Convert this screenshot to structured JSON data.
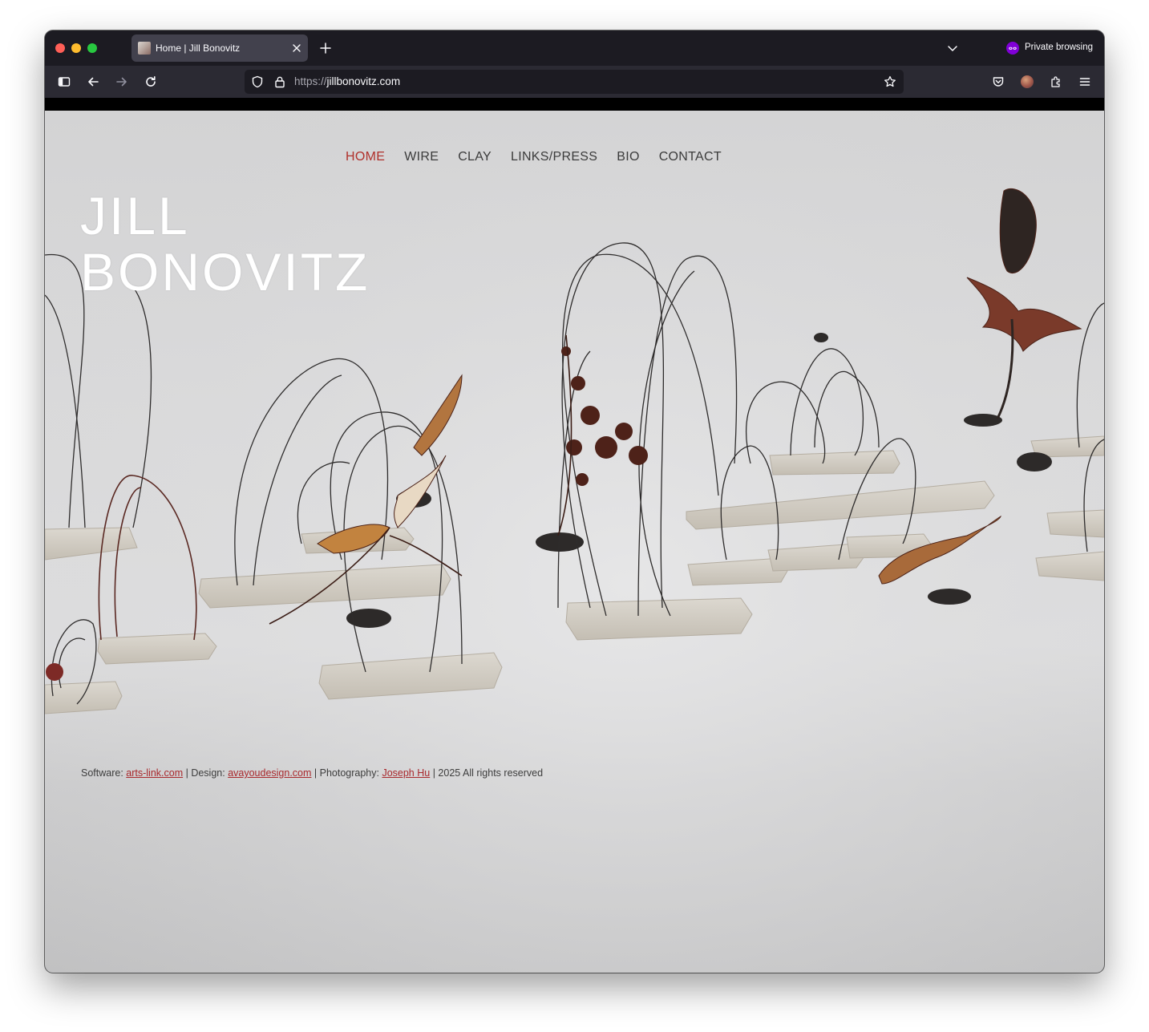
{
  "browser": {
    "tab": {
      "title": "Home | Jill Bonovitz"
    },
    "private_label": "Private browsing",
    "url": {
      "scheme": "https://",
      "host": "jillbonovitz.com"
    }
  },
  "site": {
    "nav": [
      {
        "label": "HOME",
        "active": true
      },
      {
        "label": "WIRE",
        "active": false
      },
      {
        "label": "CLAY",
        "active": false
      },
      {
        "label": "LINKS/PRESS",
        "active": false
      },
      {
        "label": "BIO",
        "active": false
      },
      {
        "label": "CONTACT",
        "active": false
      }
    ],
    "title_line1": "JILL",
    "title_line2": "BONOVITZ",
    "footer": {
      "software_label": "Software: ",
      "software_link": "arts-link.com",
      "design_label": " | Design: ",
      "design_link": "avayoudesign.com",
      "photo_label": " | Photography: ",
      "photo_link": "Joseph Hu",
      "rights": " | 2025 All rights reserved"
    }
  },
  "colors": {
    "accent": "#b0302b",
    "link": "#a8282c",
    "chrome_dark": "#1c1b22",
    "toolbar": "#2b2a33",
    "private_purple": "#8000d7"
  }
}
